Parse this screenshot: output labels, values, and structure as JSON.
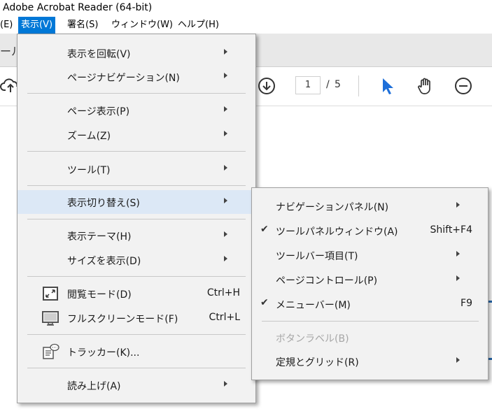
{
  "window": {
    "title": "Adobe Acrobat Reader (64-bit)"
  },
  "menubar": {
    "items": [
      {
        "label": "(E)"
      },
      {
        "label": "表示(V)"
      },
      {
        "label": "署名(S)"
      },
      {
        "label": "ウィンドウ(W)"
      },
      {
        "label": "ヘルプ(H)"
      }
    ]
  },
  "tabstrip": {
    "partial_label": "ール"
  },
  "toolbar": {
    "current_page": "1",
    "page_separator": "/",
    "total_pages": "5"
  },
  "view_menu": {
    "items": [
      {
        "label": "表示を回転(V)"
      },
      {
        "label": "ページナビゲーション(N)"
      },
      {
        "label": "ページ表示(P)"
      },
      {
        "label": "ズーム(Z)"
      },
      {
        "label": "ツール(T)"
      },
      {
        "label": "表示切り替え(S)"
      },
      {
        "label": "表示テーマ(H)"
      },
      {
        "label": "サイズを表示(D)"
      },
      {
        "label": "閲覧モード(D)",
        "shortcut": "Ctrl+H"
      },
      {
        "label": "フルスクリーンモード(F)",
        "shortcut": "Ctrl+L"
      },
      {
        "label": "トラッカー(K)..."
      },
      {
        "label": "読み上げ(A)"
      }
    ]
  },
  "show_hide_submenu": {
    "items": [
      {
        "label": "ナビゲーションパネル(N)"
      },
      {
        "label": "ツールパネルウィンドウ(A)",
        "shortcut": "Shift+F4",
        "checked": "✔"
      },
      {
        "label": "ツールバー項目(T)"
      },
      {
        "label": "ページコントロール(P)"
      },
      {
        "label": "メニューバー(M)",
        "shortcut": "F9",
        "checked": "✔"
      },
      {
        "label": "ボタンラベル(B)"
      },
      {
        "label": "定規とグリッド(R)"
      }
    ]
  },
  "colors": {
    "accent": "#0078d7",
    "highlight": "#dce8f6",
    "menu_bg": "#f2f2f2",
    "cursor_blue": "#1e6fd9"
  }
}
